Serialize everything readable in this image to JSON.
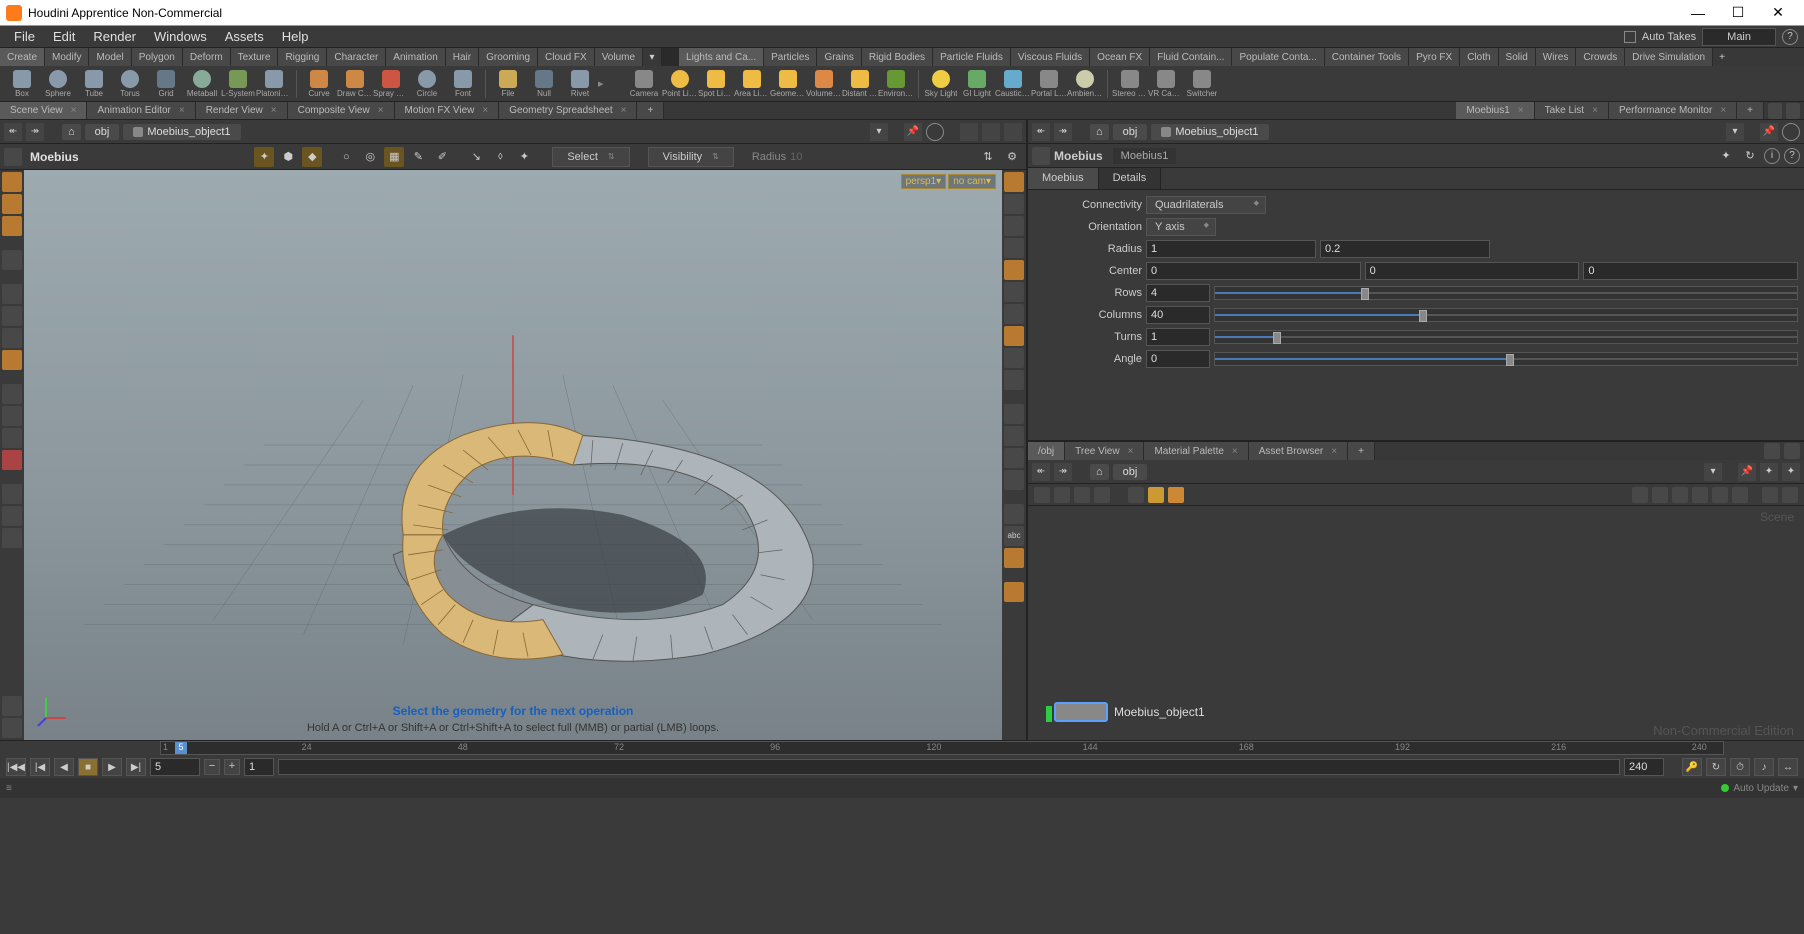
{
  "title": "Houdini Apprentice Non-Commercial",
  "menu": [
    "File",
    "Edit",
    "Render",
    "Windows",
    "Assets",
    "Help"
  ],
  "takes_label": "Auto Takes",
  "main_label": "Main",
  "shelf_tab_sets": {
    "left": [
      "Create",
      "Modify",
      "Model",
      "Polygon",
      "Deform",
      "Texture",
      "Rigging",
      "Character",
      "Animation",
      "Hair",
      "Grooming",
      "Cloud FX",
      "Volume"
    ],
    "right": [
      "Lights and Ca...",
      "Particles",
      "Grains",
      "Rigid Bodies",
      "Particle Fluids",
      "Viscous Fluids",
      "Ocean FX",
      "Fluid Contain...",
      "Populate Conta...",
      "Container Tools",
      "Pyro FX",
      "Cloth",
      "Solid",
      "Wires",
      "Crowds",
      "Drive Simulation"
    ]
  },
  "shelf_tools": {
    "left": [
      "Box",
      "Sphere",
      "Tube",
      "Torus",
      "Grid",
      "Metaball",
      "L-System",
      "Platonic Sol...",
      "Curve",
      "Draw Curve",
      "Spray Paint",
      "Circle",
      "Font",
      "File",
      "Null",
      "Rivet"
    ],
    "right": [
      "Camera",
      "Point Light",
      "Spot Light",
      "Area Light",
      "Geometry L...",
      "Volume Light",
      "Distant Light",
      "Environmen...",
      "Sky Light",
      "GI Light",
      "Caustic Light",
      "Portal Light",
      "Ambient Lig...",
      "Stereo Came...",
      "VR Camera",
      "Switcher"
    ]
  },
  "desktop_tabs": {
    "left": [
      "Scene View",
      "Animation Editor",
      "Render View",
      "Composite View",
      "Motion FX View",
      "Geometry Spreadsheet"
    ],
    "right": [
      "Moebius1",
      "Take List",
      "Performance Monitor"
    ]
  },
  "path": {
    "root": "obj",
    "node": "Moebius_object1"
  },
  "op": {
    "name": "Moebius",
    "select_label": "Select",
    "vis_label": "Visibility",
    "radius_label": "Radius",
    "radius_val": "10"
  },
  "viewport": {
    "camera": "persp1▾",
    "nocam": "no cam▾",
    "hint1": "Select the geometry for the next operation",
    "hint2": "Hold A or Ctrl+A or Shift+A or Ctrl+Shift+A to select full (MMB) or partial (LMB) loops."
  },
  "parm": {
    "header": "Moebius",
    "node": "Moebius1",
    "tabs": [
      "Moebius",
      "Details"
    ],
    "connectivity_label": "Connectivity",
    "connectivity": "Quadrilaterals",
    "orientation_label": "Orientation",
    "orientation": "Y axis",
    "radius_label": "Radius",
    "radius": [
      "1",
      "0.2"
    ],
    "center_label": "Center",
    "center": [
      "0",
      "0",
      "0"
    ],
    "rows_label": "Rows",
    "rows": "4",
    "columns_label": "Columns",
    "columns": "40",
    "turns_label": "Turns",
    "turns": "1",
    "angle_label": "Angle",
    "angle": "0"
  },
  "net": {
    "tabs": [
      "/obj",
      "Tree View",
      "Material Palette",
      "Asset Browser"
    ],
    "path": "obj",
    "node_label": "Moebius_object1",
    "watermark": "Non-Commercial Edition",
    "scene": "Scene"
  },
  "timeline": {
    "start": "1",
    "end": "240",
    "current": "5",
    "step": "1",
    "ticks": [
      "24",
      "48",
      "72",
      "96",
      "120",
      "144",
      "168",
      "192",
      "216",
      "240"
    ]
  },
  "status": {
    "update": "Auto Update"
  }
}
